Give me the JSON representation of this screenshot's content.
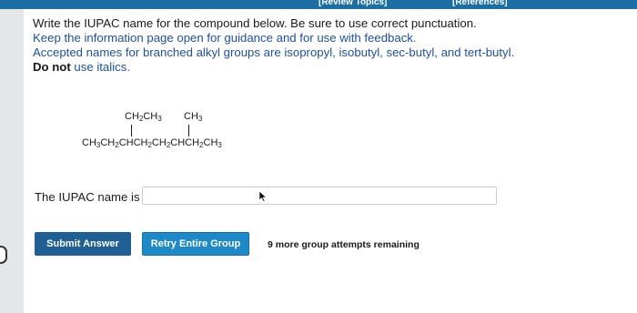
{
  "header": {
    "review_topics": "[Review Topics]",
    "references": "[References]"
  },
  "instructions": {
    "line1": "Write the IUPAC name for the compound below. Be sure to use correct punctuation.",
    "line2": "Keep the information page open for guidance and for use with feedback.",
    "line3": "Accepted names for branched alkyl groups are isopropyl, isobutyl, sec-butyl, and tert-butyl.",
    "line4_bold": "Do not",
    "line4_rest": " use italics."
  },
  "structure": {
    "substituent_ethyl": "CH₂CH₃",
    "substituent_methyl": "CH₃",
    "main_chain": "CH₃CH₂CHCH₂CH₂CHCH₂CH₃"
  },
  "answer": {
    "label": "The IUPAC name is",
    "value": "",
    "placeholder": ""
  },
  "buttons": {
    "submit": "Submit Answer",
    "retry": "Retry Entire Group"
  },
  "status": {
    "attempts": "9 more group attempts remaining"
  },
  "colors": {
    "header_bar": "#1d6fa3",
    "instruction_blue": "#1f4f9e",
    "submit_button": "#1f5f93",
    "retry_button": "#1f88c7"
  }
}
